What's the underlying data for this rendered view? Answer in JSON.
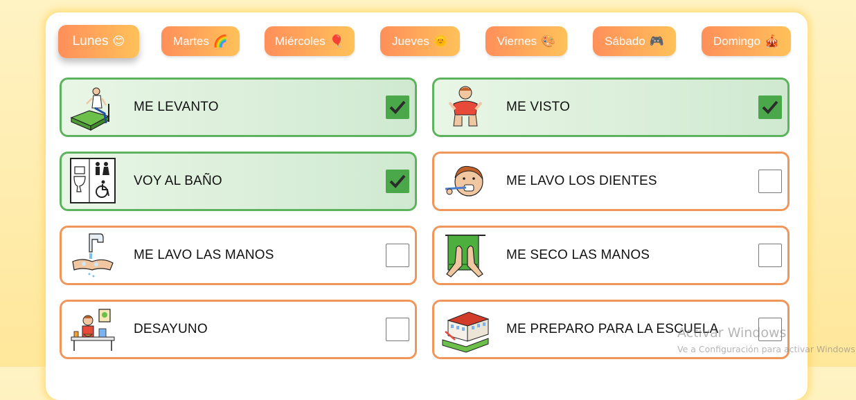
{
  "days": [
    {
      "label": "Lunes",
      "icon": "😊",
      "icon_name": "smiley-icon",
      "active": true
    },
    {
      "label": "Martes",
      "icon": "🌈",
      "icon_name": "rainbow-icon"
    },
    {
      "label": "Miércoles",
      "icon": "🎈",
      "icon_name": "balloon-icon"
    },
    {
      "label": "Jueves",
      "icon": "🌞",
      "icon_name": "sun-icon"
    },
    {
      "label": "Viernes",
      "icon": "🎨",
      "icon_name": "palette-icon"
    },
    {
      "label": "Sábado",
      "icon": "🎮",
      "icon_name": "gamepad-icon"
    },
    {
      "label": "Domingo",
      "icon": "🎪",
      "icon_name": "circus-tent-icon"
    }
  ],
  "tasks": [
    {
      "label": "ME LEVANTO",
      "checked": true,
      "picto": "bed-wakeup-pictogram"
    },
    {
      "label": "ME VISTO",
      "checked": true,
      "picto": "dressing-pictogram"
    },
    {
      "label": "VOY AL BAÑO",
      "checked": true,
      "picto": "bathroom-pictogram"
    },
    {
      "label": "ME LAVO LOS DIENTES",
      "checked": false,
      "picto": "brushing-teeth-pictogram"
    },
    {
      "label": "ME LAVO LAS MANOS",
      "checked": false,
      "picto": "washing-hands-pictogram"
    },
    {
      "label": "ME SECO LAS MANOS",
      "checked": false,
      "picto": "drying-hands-pictogram"
    },
    {
      "label": "DESAYUNO",
      "checked": false,
      "picto": "breakfast-pictogram"
    },
    {
      "label": "ME PREPARO PARA LA ESCUELA",
      "checked": false,
      "picto": "school-pictogram"
    }
  ],
  "watermark": {
    "title": "Activar Windows",
    "subtitle": "Ve a Configuración para activar Windows."
  },
  "colors": {
    "tab_gradient_start": "#ff8f5a",
    "tab_gradient_end": "#ffc15a",
    "done_border": "#5db35d",
    "pending_border": "#f0965a",
    "check_green": "#4aa84a",
    "background": "#ffe79a"
  }
}
